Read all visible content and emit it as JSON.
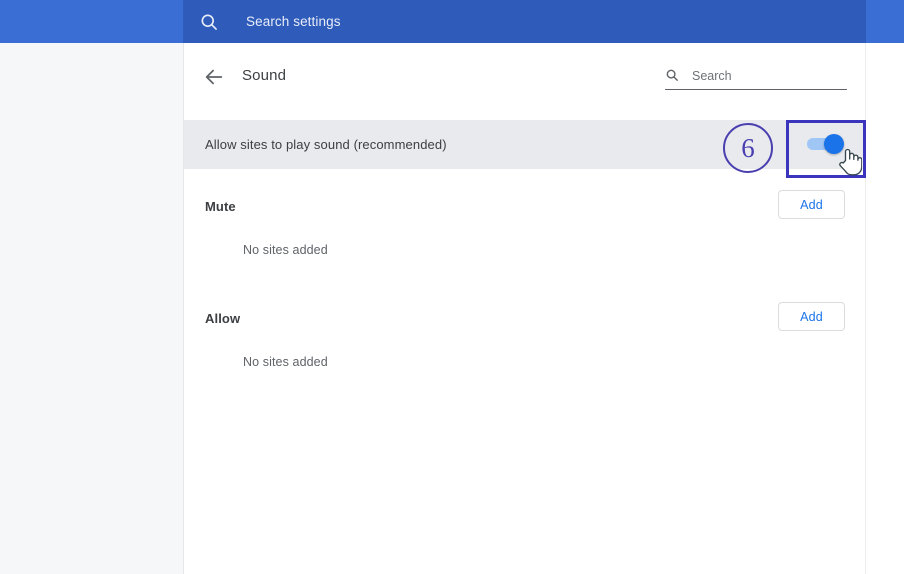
{
  "top_bar": {
    "search_icon": "search-icon",
    "search_placeholder": "Search settings"
  },
  "sub_header": {
    "back_icon": "arrow-left-icon",
    "title": "Sound",
    "search": {
      "icon": "search-icon",
      "placeholder": "Search",
      "value": ""
    }
  },
  "toggle_row": {
    "label": "Allow sites to play sound (recommended)",
    "state": "on"
  },
  "sections": [
    {
      "title": "Mute",
      "add_label": "Add",
      "empty_text": "No sites added"
    },
    {
      "title": "Allow",
      "add_label": "Add",
      "empty_text": "No sites added"
    }
  ],
  "annotation": {
    "step_number": "6",
    "circle_color": "#4a3fb0",
    "highlight_color": "#3b35bd",
    "cursor": "pointer-hand-cursor"
  },
  "colors": {
    "header_blue": "#3b6ed4",
    "search_blue": "#2f5bba",
    "row_gray": "#e8eaed",
    "accent_blue": "#1a73e8",
    "track_blue": "#9fc6f5"
  }
}
